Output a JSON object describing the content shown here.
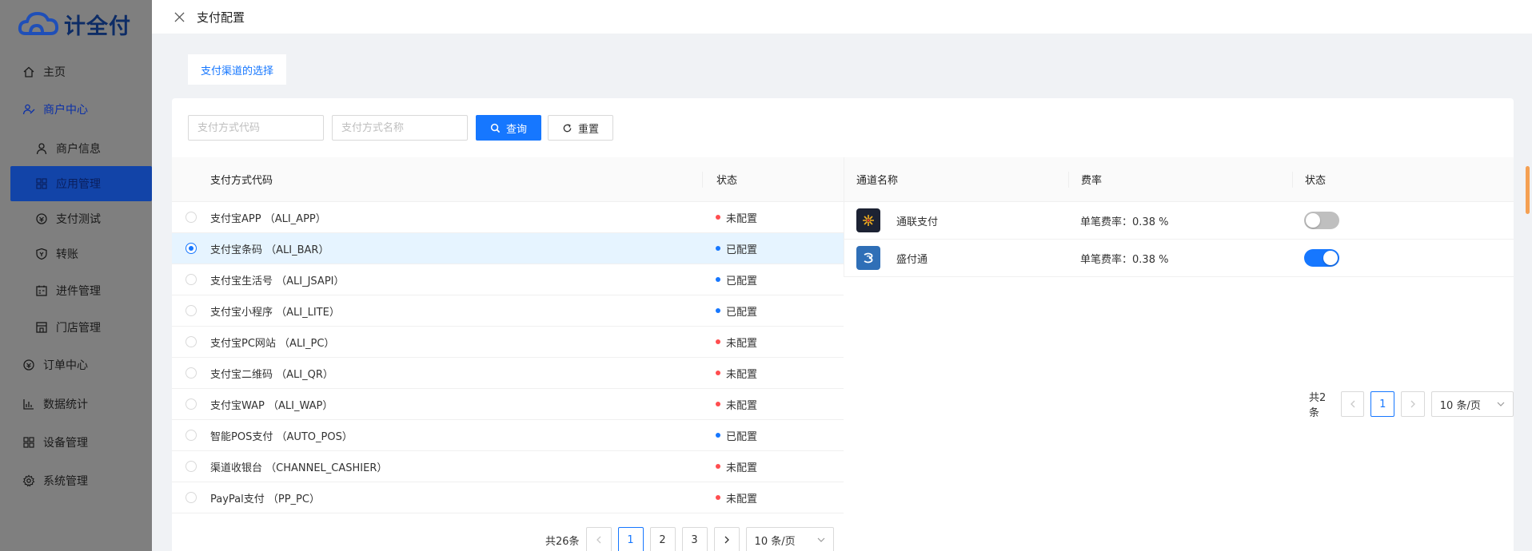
{
  "sidebar": {
    "logo_text": "计全付",
    "items": [
      {
        "label": "主页",
        "icon": "home-icon"
      },
      {
        "label": "商户中心",
        "icon": "merchant-icon"
      },
      {
        "label": "商户信息",
        "icon": "user-icon"
      },
      {
        "label": "应用管理",
        "icon": "apps-icon"
      },
      {
        "label": "支付测试",
        "icon": "payment-test-icon"
      },
      {
        "label": "转账",
        "icon": "transfer-icon"
      },
      {
        "label": "进件管理",
        "icon": "onboarding-icon"
      },
      {
        "label": "门店管理",
        "icon": "store-icon"
      },
      {
        "label": "订单中心",
        "icon": "order-icon"
      },
      {
        "label": "数据统计",
        "icon": "chart-icon"
      },
      {
        "label": "设备管理",
        "icon": "device-icon"
      },
      {
        "label": "系统管理",
        "icon": "settings-icon"
      }
    ]
  },
  "drawer": {
    "title": "支付配置",
    "tab": "支付渠道的选择"
  },
  "search": {
    "code_placeholder": "支付方式代码",
    "name_placeholder": "支付方式名称",
    "search_label": "查询",
    "reset_label": "重置"
  },
  "left_table": {
    "columns": [
      "支付方式代码",
      "状态"
    ],
    "rows": [
      {
        "name": "支付宝APP （ALI_APP）",
        "status": "未配置",
        "selected": false
      },
      {
        "name": "支付宝条码 （ALI_BAR）",
        "status": "已配置",
        "selected": true
      },
      {
        "name": "支付宝生活号 （ALI_JSAPI）",
        "status": "已配置",
        "selected": false
      },
      {
        "name": "支付宝小程序 （ALI_LITE）",
        "status": "已配置",
        "selected": false
      },
      {
        "name": "支付宝PC网站 （ALI_PC）",
        "status": "未配置",
        "selected": false
      },
      {
        "name": "支付宝二维码 （ALI_QR）",
        "status": "未配置",
        "selected": false
      },
      {
        "name": "支付宝WAP （ALI_WAP）",
        "status": "未配置",
        "selected": false
      },
      {
        "name": "智能POS支付 （AUTO_POS）",
        "status": "已配置",
        "selected": false
      },
      {
        "name": "渠道收银台 （CHANNEL_CASHIER）",
        "status": "未配置",
        "selected": false
      },
      {
        "name": "PayPal支付 （PP_PC）",
        "status": "未配置",
        "selected": false
      }
    ],
    "pagination": {
      "total": "共26条",
      "pages": [
        "1",
        "2",
        "3"
      ],
      "current": "1",
      "page_size": "10 条/页"
    }
  },
  "right_table": {
    "columns": [
      "通道名称",
      "费率",
      "状态"
    ],
    "rows": [
      {
        "name": "通联支付",
        "rate_label": "单笔费率：",
        "rate": "0.38 %",
        "enabled": false
      },
      {
        "name": "盛付通",
        "rate_label": "单笔费率：",
        "rate": "0.38 %",
        "enabled": true
      }
    ],
    "pagination": {
      "total": "共2条",
      "pages": [
        "1"
      ],
      "current": "1",
      "page_size": "10 条/页"
    }
  },
  "colors": {
    "primary": "#1677ff",
    "status_configured": "#1677ff",
    "status_unconfigured": "#ff4d4f",
    "selected_row_bg": "#e6f4ff"
  }
}
